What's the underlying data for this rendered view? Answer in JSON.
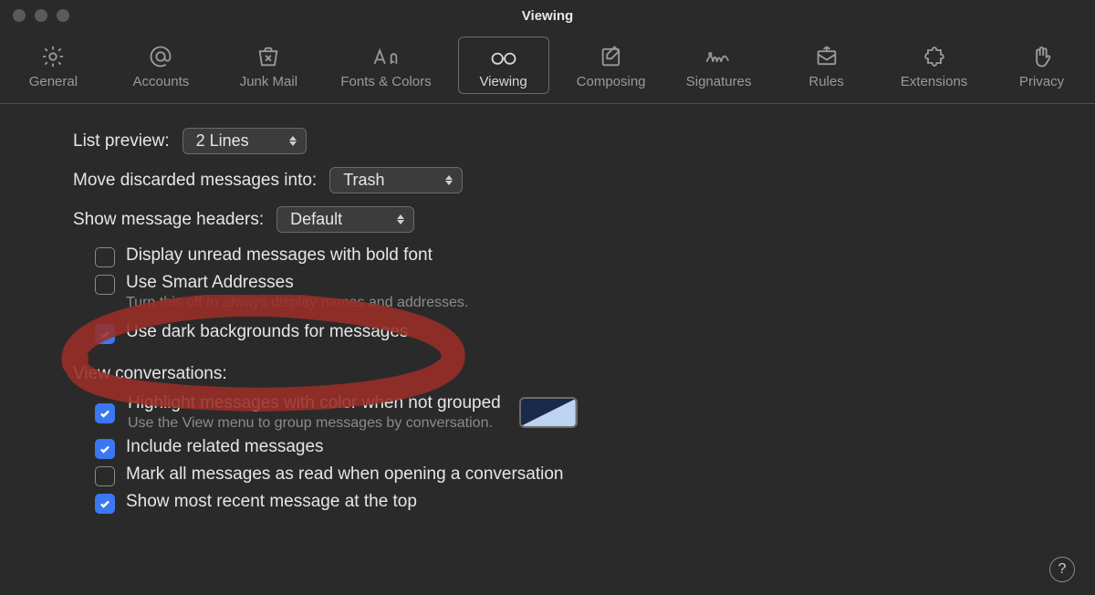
{
  "titlebar": {
    "title": "Viewing"
  },
  "tabs": {
    "general": {
      "label": "General"
    },
    "accounts": {
      "label": "Accounts"
    },
    "junk": {
      "label": "Junk Mail"
    },
    "fonts": {
      "label": "Fonts & Colors"
    },
    "viewing": {
      "label": "Viewing"
    },
    "composing": {
      "label": "Composing"
    },
    "signatures": {
      "label": "Signatures"
    },
    "rules": {
      "label": "Rules"
    },
    "extensions": {
      "label": "Extensions"
    },
    "privacy": {
      "label": "Privacy"
    }
  },
  "settings": {
    "listPreview": {
      "label": "List preview:",
      "value": "2 Lines"
    },
    "moveDiscarded": {
      "label": "Move discarded messages into:",
      "value": "Trash"
    },
    "showHeaders": {
      "label": "Show message headers:",
      "value": "Default"
    },
    "boldUnread": {
      "label": "Display unread messages with bold font",
      "checked": false
    },
    "smartAddresses": {
      "label": "Use Smart Addresses",
      "sub": "Turn this off to always display names and addresses.",
      "checked": false
    },
    "darkBg": {
      "label": "Use dark backgrounds for messages",
      "checked": true
    },
    "conversationsHeader": "View conversations:",
    "highlight": {
      "label": "Highlight messages with color when not grouped",
      "sub": "Use the View menu to group messages by conversation.",
      "checked": true
    },
    "includeRelated": {
      "label": "Include related messages",
      "checked": true
    },
    "markRead": {
      "label": "Mark all messages as read when opening a conversation",
      "checked": false
    },
    "recentTop": {
      "label": "Show most recent message at the top",
      "checked": true
    }
  },
  "help": "?"
}
